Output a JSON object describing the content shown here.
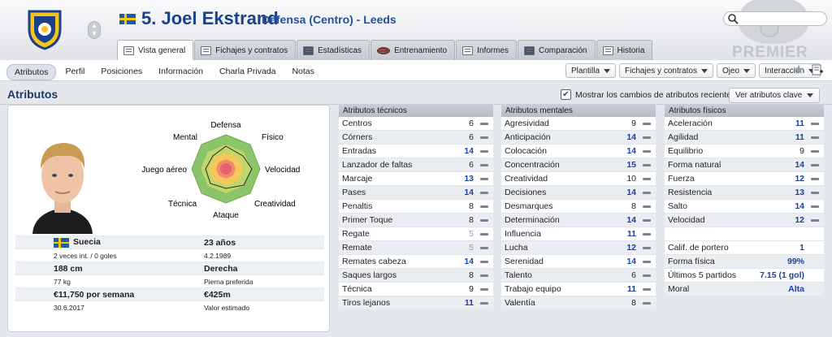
{
  "header": {
    "player_number": "5. Joel Ekstrand",
    "position_club": "Defensa (Centro) - Leeds",
    "search_placeholder": "",
    "league_logo_text": "PREMIER",
    "icons": [
      "club-crest-icon",
      "player-nav-stepper-icon",
      "sweden-flag-icon",
      "search-icon",
      "premier-league-logo"
    ]
  },
  "tabs": [
    {
      "label": "Vista general",
      "active": true,
      "icon": "overview-icon"
    },
    {
      "label": "Fichajes y contratos",
      "active": false,
      "icon": "contract-icon"
    },
    {
      "label": "Estadísticas",
      "active": false,
      "icon": "stats-icon"
    },
    {
      "label": "Entrenamiento",
      "active": false,
      "icon": "training-ball-icon"
    },
    {
      "label": "Informes",
      "active": false,
      "icon": "report-icon"
    },
    {
      "label": "Comparación",
      "active": false,
      "icon": "compare-icon"
    },
    {
      "label": "Historia",
      "active": false,
      "icon": "history-icon"
    }
  ],
  "subnav": [
    "Atributos",
    "Perfil",
    "Posiciones",
    "Información",
    "Charla Privada",
    "Notas"
  ],
  "dropdowns": [
    "Plantilla",
    "Fichajes y contratos",
    "Ojeo",
    "Interacción"
  ],
  "section": {
    "title": "Atributos",
    "show_changes_label": "Mostrar los cambios de atributos recientes",
    "show_changes_checked": true,
    "view_button": "Ver atributos clave"
  },
  "radar": {
    "labels": {
      "top": "Defensa",
      "top_right": "Físico",
      "right": "Velocidad",
      "bottom_right": "Creatividad",
      "bottom": "Ataque",
      "bottom_left": "Técnica",
      "left": "Juego aéreo",
      "top_left": "Mental"
    }
  },
  "bio": {
    "nationality": "Suecia",
    "caps": "2 veces int. / 0 goles",
    "age": "23 años",
    "dob": "4.2.1989",
    "height": "188 cm",
    "foot": "Derecha",
    "weight": "77 kg",
    "foot_label": "Pierna preferida",
    "wage": "€11,750 por semana",
    "value": "€425m",
    "contract_end": "30.6.2017",
    "value_label": "Valor estimado"
  },
  "technical": {
    "title": "Atributos técnicos",
    "rows": [
      {
        "name": "Centros",
        "value": "6"
      },
      {
        "name": "Córners",
        "value": "6"
      },
      {
        "name": "Entradas",
        "value": "14"
      },
      {
        "name": "Lanzador de faltas",
        "value": "6"
      },
      {
        "name": "Marcaje",
        "value": "13"
      },
      {
        "name": "Pases",
        "value": "14"
      },
      {
        "name": "Penaltis",
        "value": "8"
      },
      {
        "name": "Primer Toque",
        "value": "8"
      },
      {
        "name": "Regate",
        "value": "5"
      },
      {
        "name": "Remate",
        "value": "5"
      },
      {
        "name": "Remates cabeza",
        "value": "14"
      },
      {
        "name": "Saques largos",
        "value": "8"
      },
      {
        "name": "Técnica",
        "value": "9"
      },
      {
        "name": "Tiros lejanos",
        "value": "11"
      }
    ]
  },
  "mental": {
    "title": "Atributos mentales",
    "rows": [
      {
        "name": "Agresividad",
        "value": "9"
      },
      {
        "name": "Anticipación",
        "value": "14"
      },
      {
        "name": "Colocación",
        "value": "14"
      },
      {
        "name": "Concentración",
        "value": "15"
      },
      {
        "name": "Creatividad",
        "value": "10"
      },
      {
        "name": "Decisiones",
        "value": "14"
      },
      {
        "name": "Desmarques",
        "value": "8"
      },
      {
        "name": "Determinación",
        "value": "14"
      },
      {
        "name": "Influencia",
        "value": "11"
      },
      {
        "name": "Lucha",
        "value": "12"
      },
      {
        "name": "Serenidad",
        "value": "14"
      },
      {
        "name": "Talento",
        "value": "6"
      },
      {
        "name": "Trabajo equipo",
        "value": "11"
      },
      {
        "name": "Valentía",
        "value": "8"
      }
    ]
  },
  "physical": {
    "title": "Atributos físicos",
    "rows": [
      {
        "name": "Aceleración",
        "value": "11"
      },
      {
        "name": "Agilidad",
        "value": "11"
      },
      {
        "name": "Equilibrio",
        "value": "9"
      },
      {
        "name": "Forma natural",
        "value": "14"
      },
      {
        "name": "Fuerza",
        "value": "12"
      },
      {
        "name": "Resistencia",
        "value": "13"
      },
      {
        "name": "Salto",
        "value": "14"
      },
      {
        "name": "Velocidad",
        "value": "12"
      }
    ],
    "extra": [
      {
        "name": "Calif. de portero",
        "value": "1"
      },
      {
        "name": "Forma física",
        "value": "99%"
      },
      {
        "name": "Últimos 5 partidos",
        "value": "7.15 (1 gol)"
      },
      {
        "name": "Moral",
        "value": "Alta"
      }
    ]
  },
  "colors": {
    "title_blue": "#19428a",
    "high_value": "#1a3fa0",
    "muted_value": "#999999"
  }
}
